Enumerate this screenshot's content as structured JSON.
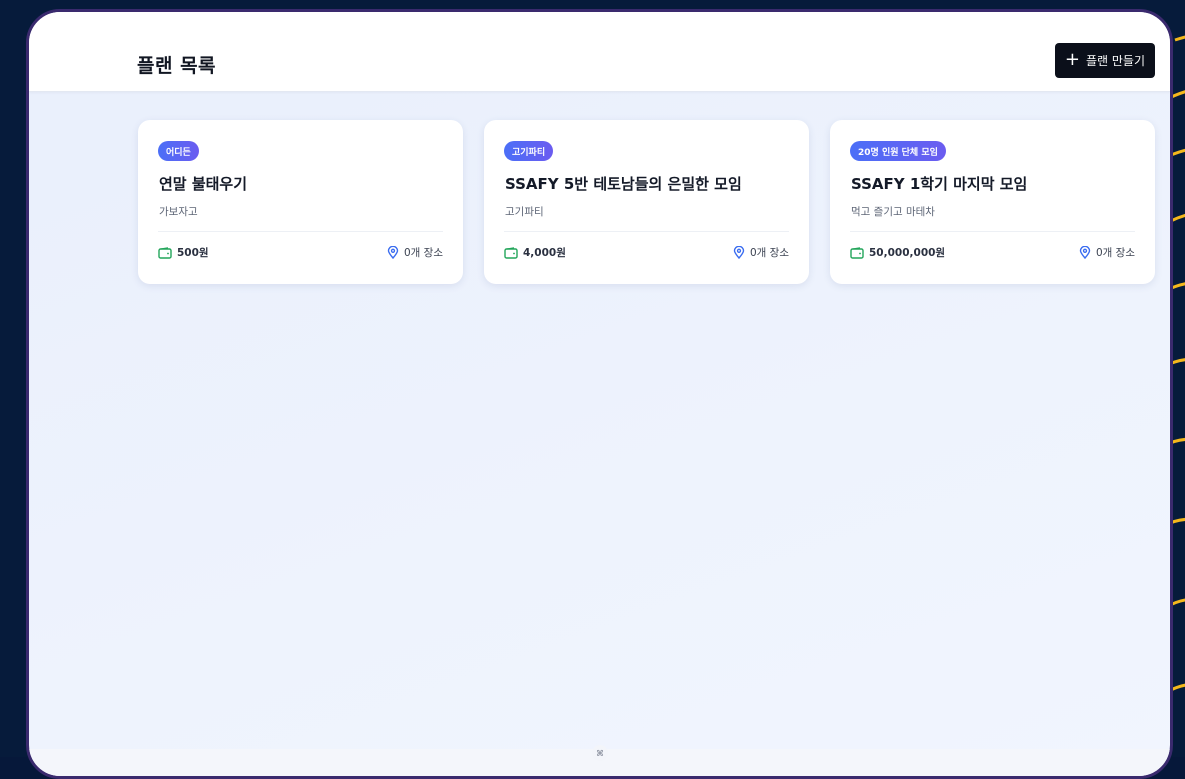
{
  "header": {
    "title": "플랜 목록",
    "create_button": {
      "icon": "plus-icon",
      "label": "플랜 만들기"
    }
  },
  "plans": [
    {
      "badge": "어디든",
      "title": "연말 불태우기",
      "description": "가보자고",
      "budget": "500원",
      "places": "0개 장소"
    },
    {
      "badge": "고기파티",
      "title": "SSAFY 5반 테토남들의 은밀한 모임",
      "description": "고기파티",
      "budget": "4,000원",
      "places": "0개 장소"
    },
    {
      "badge": "20명 인원 단체 모임",
      "title": "SSAFY 1학기 마지막 모임",
      "description": "먹고 즐기고 마테차",
      "budget": "50,000,000원",
      "places": "0개 장소"
    }
  ],
  "colors": {
    "badge_start": "#4b6ff7",
    "badge_end": "#6b5cf0",
    "wallet_icon": "#22a55a",
    "pin_icon": "#3b6df0",
    "button_bg": "#0b0f1a",
    "frame_border": "#3a2a6e",
    "backdrop": "#061b3b",
    "deco_arcs": "#f5b81c"
  },
  "icons": {
    "budget": "wallet-icon",
    "places": "map-pin-icon"
  }
}
